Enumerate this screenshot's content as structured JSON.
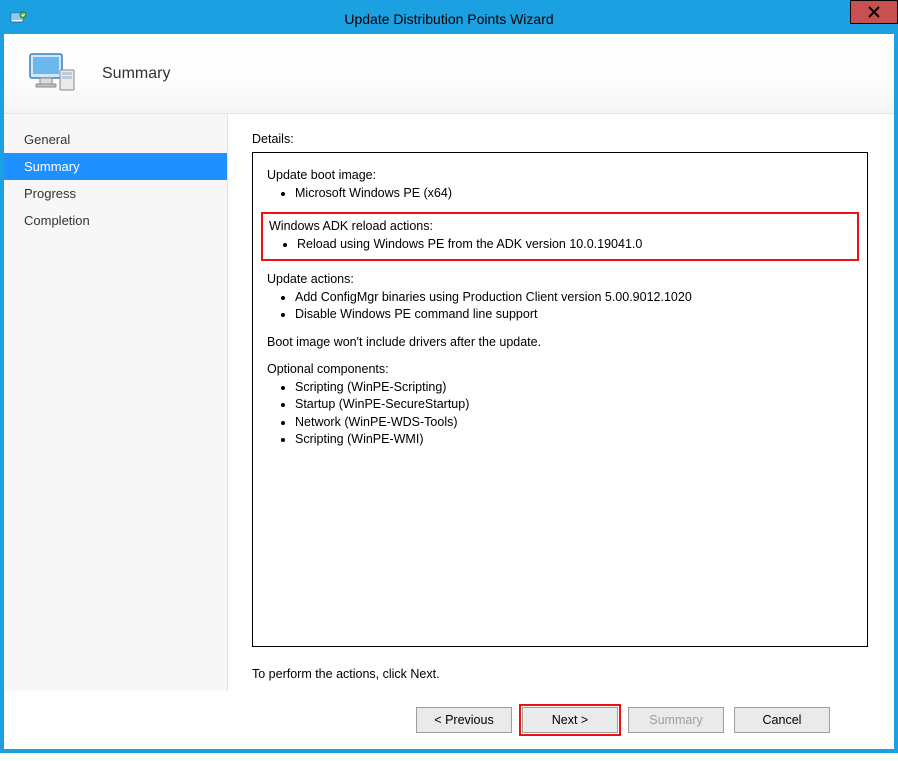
{
  "titlebar": {
    "title": "Update Distribution Points Wizard"
  },
  "header": {
    "page_title": "Summary"
  },
  "sidebar": {
    "items": [
      {
        "label": "General",
        "selected": false
      },
      {
        "label": "Summary",
        "selected": true
      },
      {
        "label": "Progress",
        "selected": false
      },
      {
        "label": "Completion",
        "selected": false
      }
    ]
  },
  "content": {
    "details_label": "Details:",
    "update_boot_image": {
      "heading": "Update boot image:",
      "items": [
        "Microsoft Windows PE (x64)"
      ]
    },
    "adk_reload": {
      "heading": "Windows ADK reload actions:",
      "items": [
        "Reload using Windows PE from the  ADK version 10.0.19041.0"
      ]
    },
    "update_actions": {
      "heading": "Update actions:",
      "items": [
        "Add ConfigMgr binaries using Production Client version 5.00.9012.1020",
        "Disable Windows PE command line support"
      ]
    },
    "no_drivers_note": "Boot image won't include drivers after the update.",
    "optional_components": {
      "heading": "Optional components:",
      "items": [
        "Scripting (WinPE-Scripting)",
        "Startup (WinPE-SecureStartup)",
        "Network (WinPE-WDS-Tools)",
        "Scripting (WinPE-WMI)"
      ]
    },
    "instruction": "To perform the actions, click Next."
  },
  "buttons": {
    "previous": "< Previous",
    "next": "Next >",
    "summary": "Summary",
    "cancel": "Cancel"
  }
}
